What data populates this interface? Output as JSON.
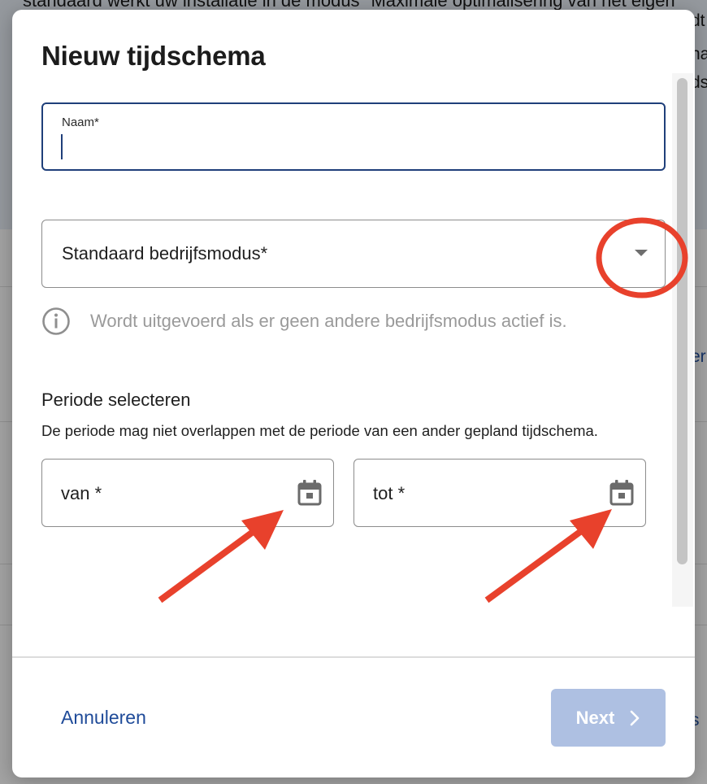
{
  "background": {
    "top_text": "standaard werkt uw installatie in de modus \"Maximale optimalisering van het eigen",
    "right_fragments": [
      "dt",
      "na",
      "ds",
      "er",
      "s"
    ]
  },
  "dialog": {
    "title": "Nieuw tijdschema",
    "name_field": {
      "label": "Naam*",
      "value": ""
    },
    "mode_select": {
      "value": "Standaard bedrijfsmodus*"
    },
    "helper_text": "Wordt uitgevoerd als er geen andere bedrijfsmodus actief is.",
    "period": {
      "heading": "Periode selecteren",
      "description": "De periode mag niet overlappen met de periode van een ander gepland tijdschema.",
      "from_label": "van *",
      "to_label": "tot *"
    },
    "footer": {
      "cancel_label": "Annuleren",
      "next_label": "Next"
    }
  },
  "colors": {
    "accent": "#1f3f7a",
    "link": "#1f4b99",
    "button_disabled": "#aec0e2",
    "annotation": "#e8412c"
  },
  "icons": [
    "info-icon",
    "calendar-icon",
    "chevron-down-icon",
    "chevron-right-icon"
  ]
}
